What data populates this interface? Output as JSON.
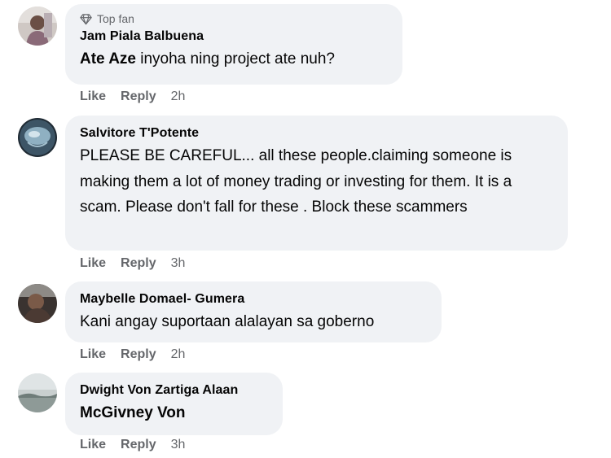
{
  "comments": [
    {
      "badge": "Top fan",
      "badge_icon": "diamond-icon",
      "author": "Jam Piala Balbuena",
      "mention": "Ate Aze",
      "text": " inyoha ning project ate nuh?",
      "like": "Like",
      "reply": "Reply",
      "time": "2h"
    },
    {
      "author": "Salvitore T'Potente",
      "text": "PLEASE BE CAREFUL... all these people.claiming someone is making them a lot of money trading or investing for them. It is a scam. Please don't fall for these . Block these scammers",
      "like": "Like",
      "reply": "Reply",
      "time": "3h"
    },
    {
      "author": "Maybelle Domael- Gumera",
      "text": "Kani angay suportaan alalayan sa goberno",
      "like": "Like",
      "reply": "Reply",
      "time": "2h"
    },
    {
      "author": "Dwight Von Zartiga Alaan",
      "text": "McGivney Von",
      "like": "Like",
      "reply": "Reply",
      "time": "3h"
    }
  ]
}
